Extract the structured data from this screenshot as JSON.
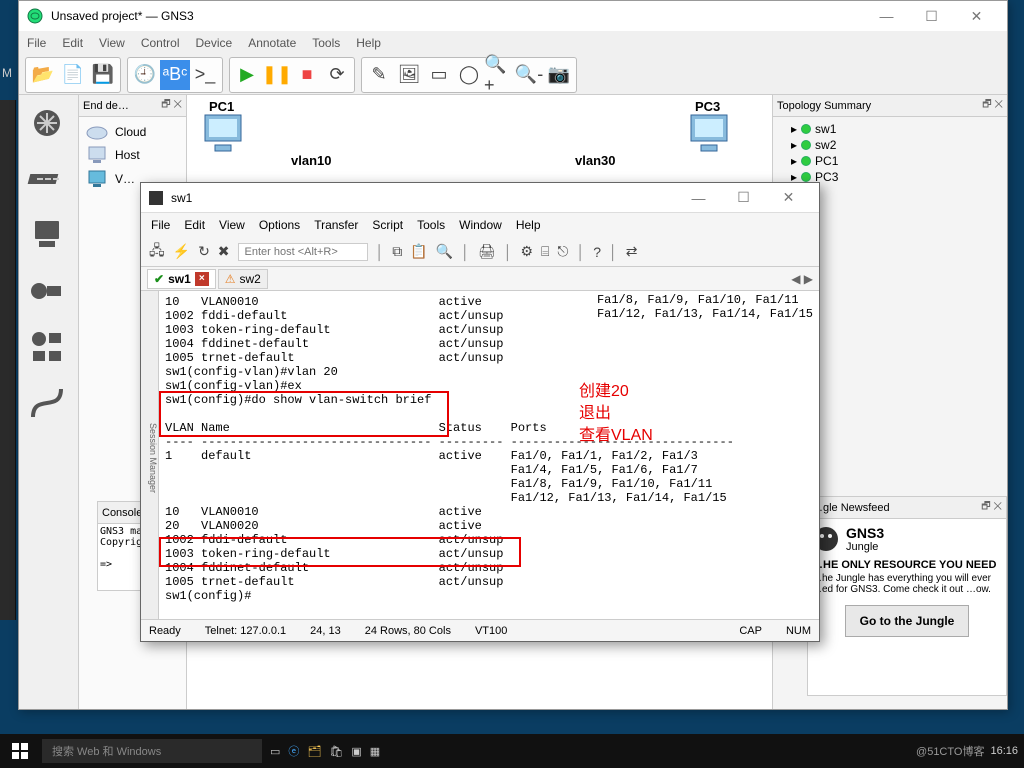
{
  "gns": {
    "title": "Unsaved project* — GNS3",
    "menu": [
      "File",
      "Edit",
      "View",
      "Control",
      "Device",
      "Annotate",
      "Tools",
      "Help"
    ],
    "end_devices_title": "End de…",
    "devices": [
      {
        "label": "Cloud"
      },
      {
        "label": "Host"
      },
      {
        "label": "V…"
      }
    ],
    "canvas": {
      "pc1": "PC1",
      "pc3": "PC3",
      "vlan10": "vlan10",
      "vlan30": "vlan30"
    },
    "topology_title": "Topology Summary",
    "topology_items": [
      "sw1",
      "sw2",
      "PC1",
      "PC3"
    ],
    "console_title": "Console",
    "console_text": "GNS3 ma…\nCopyrigh\n\n=>",
    "jungle_title": "…gle Newsfeed",
    "jungle_brand": "GNS3",
    "jungle_sub": "Jungle",
    "jungle_headline": "…HE ONLY RESOURCE YOU NEED",
    "jungle_body": "…he Jungle has everything you will ever …ed for GNS3. Come check it out …ow.",
    "jungle_btn": "Go to the Jungle"
  },
  "term": {
    "title": "sw1",
    "menu": [
      "File",
      "Edit",
      "View",
      "Options",
      "Transfer",
      "Script",
      "Tools",
      "Window",
      "Help"
    ],
    "host_placeholder": "Enter host <Alt+R>",
    "tabs": [
      {
        "name": "sw1",
        "active": true
      },
      {
        "name": "sw2",
        "active": false
      }
    ],
    "content_top_right": "Fa1/8, Fa1/9, Fa1/10, Fa1/11\nFa1/12, Fa1/13, Fa1/14, Fa1/15",
    "block1": "10   VLAN0010                         active\n1002 fddi-default                     act/unsup\n1003 token-ring-default               act/unsup\n1004 fddinet-default                  act/unsup\n1005 trnet-default                    act/unsup",
    "config_block": "sw1(config-vlan)#vlan 20\nsw1(config-vlan)#ex\nsw1(config)#do show vlan-switch brief",
    "header_row": "VLAN Name                             Status    Ports\n---- -------------------------------- --------- -------------------------------",
    "default_row": "1    default                          active    Fa1/0, Fa1/1, Fa1/2, Fa1/3\n                                                Fa1/4, Fa1/5, Fa1/6, Fa1/7\n                                                Fa1/8, Fa1/9, Fa1/10, Fa1/11\n                                                Fa1/12, Fa1/13, Fa1/14, Fa1/15",
    "vlan_rows": "10   VLAN0010                         active\n20   VLAN0020                         active",
    "block2": "1002 fddi-default                     act/unsup\n1003 token-ring-default               act/unsup\n1004 fddinet-default                  act/unsup\n1005 trnet-default                    act/unsup\nsw1(config)#",
    "annotations": {
      "a1": "创建20",
      "a2": "退出",
      "a3": "查看VLAN"
    },
    "status": {
      "ready": "Ready",
      "telnet": "Telnet: 127.0.0.1",
      "pos": "24, 13",
      "size": "24 Rows, 80 Cols",
      "vt": "VT100",
      "cap": "CAP",
      "num": "NUM"
    }
  },
  "taskbar": {
    "search": "搜索 Web 和 Windows",
    "time": "16:16",
    "watermark": "@51CTO博客"
  },
  "chart_data": {
    "type": "table",
    "title": "show vlan-switch brief — sw1",
    "columns": [
      "VLAN",
      "Name",
      "Status",
      "Ports"
    ],
    "rows": [
      {
        "VLAN": 1,
        "Name": "default",
        "Status": "active",
        "Ports": "Fa1/0-Fa1/15"
      },
      {
        "VLAN": 10,
        "Name": "VLAN0010",
        "Status": "active",
        "Ports": ""
      },
      {
        "VLAN": 20,
        "Name": "VLAN0020",
        "Status": "active",
        "Ports": ""
      },
      {
        "VLAN": 1002,
        "Name": "fddi-default",
        "Status": "act/unsup",
        "Ports": ""
      },
      {
        "VLAN": 1003,
        "Name": "token-ring-default",
        "Status": "act/unsup",
        "Ports": ""
      },
      {
        "VLAN": 1004,
        "Name": "fddinet-default",
        "Status": "act/unsup",
        "Ports": ""
      },
      {
        "VLAN": 1005,
        "Name": "trnet-default",
        "Status": "act/unsup",
        "Ports": ""
      }
    ]
  }
}
